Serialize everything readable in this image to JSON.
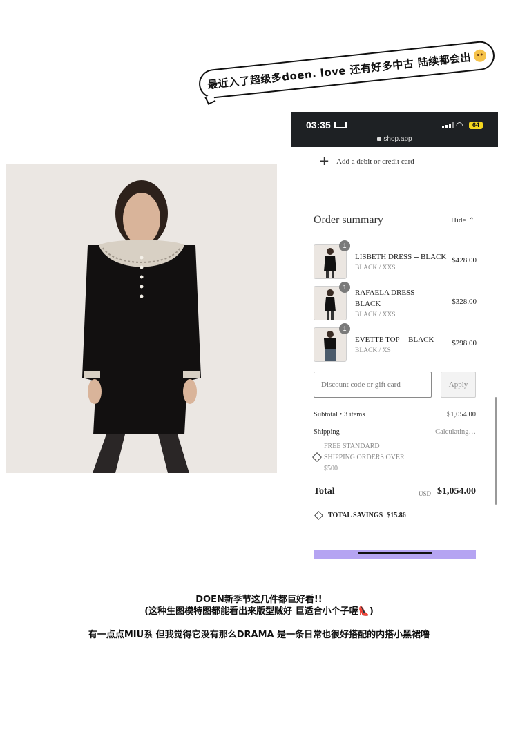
{
  "bubble": {
    "text": "最近入了超级多doen. love 还有好多中古 陆续都会出"
  },
  "status_bar": {
    "time": "03:35",
    "battery": "64",
    "url": "shop.app"
  },
  "checkout": {
    "add_card_label": "Add a debit or credit card",
    "order_summary_title": "Order summary",
    "hide_label": "Hide",
    "items": [
      {
        "name": "LISBETH DRESS -- BLACK",
        "variant": "BLACK / XXS",
        "price": "$428.00",
        "qty": "1"
      },
      {
        "name": "RAFAELA DRESS -- BLACK",
        "variant": "BLACK / XXS",
        "price": "$328.00",
        "qty": "1"
      },
      {
        "name": "EVETTE TOP -- BLACK",
        "variant": "BLACK / XS",
        "price": "$298.00",
        "qty": "1"
      }
    ],
    "discount_placeholder": "Discount code or gift card",
    "apply_label": "Apply",
    "subtotal_label": "Subtotal • 3 items",
    "subtotal_value": "$1,054.00",
    "shipping_label": "Shipping",
    "shipping_value": "Calculating…",
    "shipping_note": "FREE STANDARD SHIPPING ORDERS OVER $500",
    "total_label": "Total",
    "total_currency": "USD",
    "total_value": "$1,054.00",
    "savings_label": "TOTAL SAVINGS",
    "savings_value": "$15.86"
  },
  "captions": {
    "line1": "DOEN新季节这几件都巨好看!!",
    "line2": "(这种生图模特图都能看出来版型贼好 巨适合小个子喔👠)",
    "line3": "有一点点MIU系 但我觉得它没有那么DRAMA 是一条日常也很好搭配的内搭小黑裙噜"
  },
  "colors": {
    "accent_purple": "#b5a4f2",
    "status_bar_bg": "#1e2124",
    "battery_yellow": "#f5d71f"
  }
}
